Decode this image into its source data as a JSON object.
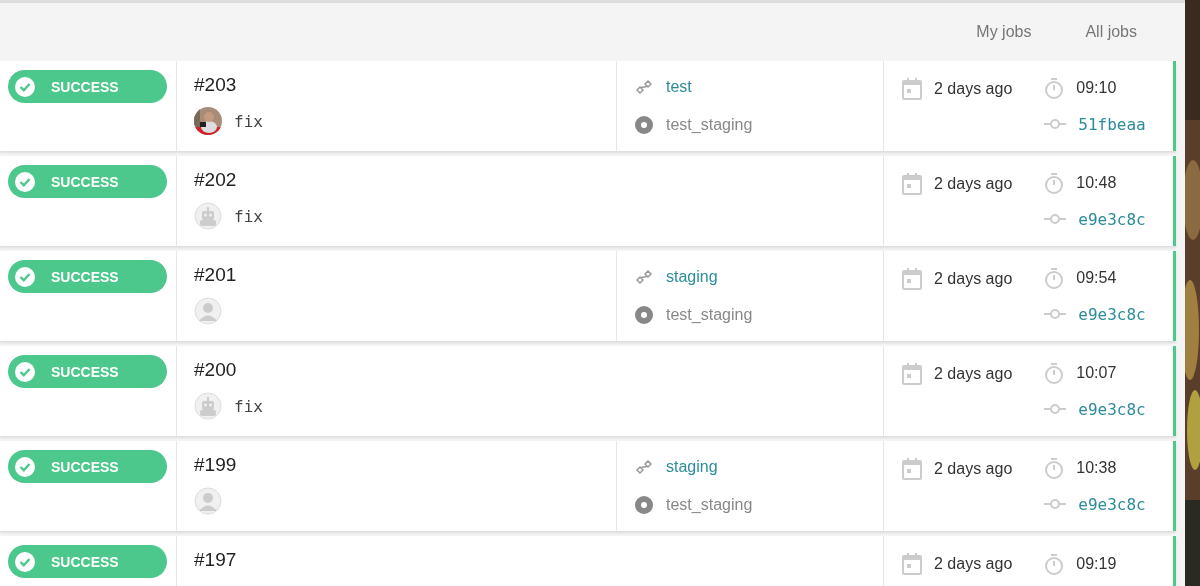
{
  "tabs": [
    {
      "label": "My jobs"
    },
    {
      "label": "All jobs"
    }
  ],
  "jobs": [
    {
      "status": "SUCCESS",
      "number": "#203",
      "message": "fix",
      "pipeline": "test",
      "target": "test_staging",
      "date": "2 days ago",
      "duration": "09:10",
      "commit": "51fbeaa"
    },
    {
      "status": "SUCCESS",
      "number": "#202",
      "avatar": {
        "kind": "robot"
      },
      "message": "fix",
      "date": "2 days ago",
      "duration": "10:48",
      "commit": "e9e3c8c"
    },
    {
      "status": "SUCCESS",
      "number": "#201",
      "avatar": {
        "kind": "person"
      },
      "pipeline": "staging",
      "target": "test_staging",
      "date": "2 days ago",
      "duration": "09:54",
      "commit": "e9e3c8c"
    },
    {
      "status": "SUCCESS",
      "number": "#200",
      "avatar": {
        "kind": "robot"
      },
      "message": "fix",
      "date": "2 days ago",
      "duration": "10:07",
      "commit": "e9e3c8c"
    },
    {
      "status": "SUCCESS",
      "number": "#199",
      "avatar": {
        "kind": "person"
      },
      "pipeline": "staging",
      "target": "test_staging",
      "date": "2 days ago",
      "duration": "10:38",
      "commit": "e9e3c8c"
    },
    {
      "status": "SUCCESS",
      "number": "#197",
      "date": "2 days ago",
      "duration": "09:19"
    }
  ]
}
